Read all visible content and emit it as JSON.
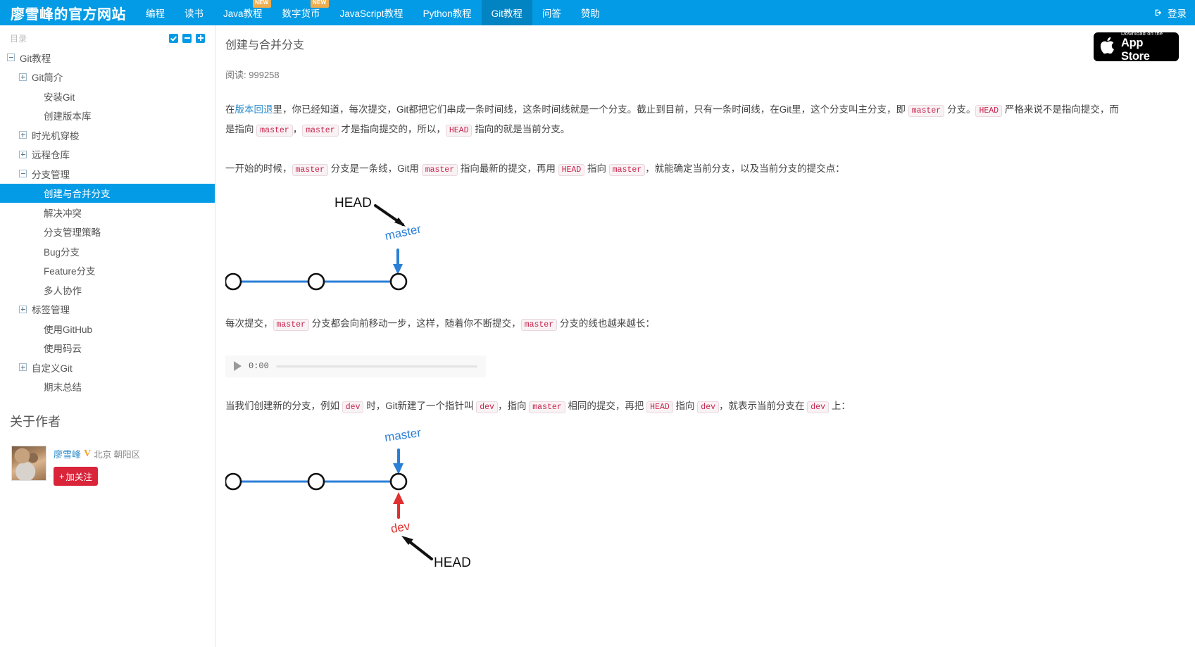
{
  "navbar": {
    "brand": "廖雪峰的官方网站",
    "items": [
      {
        "label": "编程",
        "badge": null,
        "active": false
      },
      {
        "label": "读书",
        "badge": null,
        "active": false
      },
      {
        "label": "Java教程",
        "badge": "NEW",
        "active": false
      },
      {
        "label": "数字货币",
        "badge": "NEW",
        "active": false
      },
      {
        "label": "JavaScript教程",
        "badge": null,
        "active": false
      },
      {
        "label": "Python教程",
        "badge": null,
        "active": false
      },
      {
        "label": "Git教程",
        "badge": null,
        "active": true
      },
      {
        "label": "问答",
        "badge": null,
        "active": false
      },
      {
        "label": "赞助",
        "badge": null,
        "active": false
      }
    ],
    "login_label": "登录",
    "login_icon": "sign-in-icon",
    "bg_color": "#039BE5",
    "active_bg_color": "#0283c2"
  },
  "sidebar": {
    "toc_title": "目录",
    "toc_actions": [
      {
        "name": "check-all-button",
        "icon": "check-icon"
      },
      {
        "name": "collapse-all-button",
        "icon": "minus-icon"
      },
      {
        "name": "expand-all-button",
        "icon": "plus-icon"
      }
    ],
    "tree": [
      {
        "label": "Git教程",
        "indent": 0,
        "toggle": "minus",
        "selected": false
      },
      {
        "label": "Git简介",
        "indent": 1,
        "toggle": "plus",
        "selected": false
      },
      {
        "label": "安装Git",
        "indent": 2,
        "toggle": "none",
        "selected": false
      },
      {
        "label": "创建版本库",
        "indent": 2,
        "toggle": "none",
        "selected": false
      },
      {
        "label": "时光机穿梭",
        "indent": 1,
        "toggle": "plus",
        "selected": false
      },
      {
        "label": "远程仓库",
        "indent": 1,
        "toggle": "plus",
        "selected": false
      },
      {
        "label": "分支管理",
        "indent": 1,
        "toggle": "minus",
        "selected": false
      },
      {
        "label": "创建与合并分支",
        "indent": 2,
        "toggle": "none",
        "selected": true
      },
      {
        "label": "解决冲突",
        "indent": 2,
        "toggle": "none",
        "selected": false
      },
      {
        "label": "分支管理策略",
        "indent": 2,
        "toggle": "none",
        "selected": false
      },
      {
        "label": "Bug分支",
        "indent": 2,
        "toggle": "none",
        "selected": false
      },
      {
        "label": "Feature分支",
        "indent": 2,
        "toggle": "none",
        "selected": false
      },
      {
        "label": "多人协作",
        "indent": 2,
        "toggle": "none",
        "selected": false
      },
      {
        "label": "标签管理",
        "indent": 1,
        "toggle": "plus",
        "selected": false
      },
      {
        "label": "使用GitHub",
        "indent": 2,
        "toggle": "none",
        "selected": false
      },
      {
        "label": "使用码云",
        "indent": 2,
        "toggle": "none",
        "selected": false
      },
      {
        "label": "自定义Git",
        "indent": 1,
        "toggle": "plus",
        "selected": false
      },
      {
        "label": "期末总结",
        "indent": 2,
        "toggle": "none",
        "selected": false
      }
    ],
    "about_title": "关于作者",
    "author": {
      "name": "廖雪峰",
      "verified_badge": "V",
      "location": "北京 朝阳区",
      "follow_label": "加关注",
      "follow_plus": "+",
      "follow_color": "#d9243a",
      "avatar_alt": "author-avatar"
    }
  },
  "main": {
    "title": "创建与合并分支",
    "read_label": "阅读:",
    "read_count": "999258",
    "appstore": {
      "line1": "Download on the",
      "line2": "App Store",
      "icon": "apple-icon"
    },
    "paragraph1": {
      "p1": "在",
      "link": "版本回退",
      "p2": "里，你已经知道，每次提交，Git都把它们串成一条时间线，这条时间线就是一个分支。截止到目前，只有一条时间线，在Git里，这个分支叫主分支，即 ",
      "code1": "master",
      "p3": " 分支。",
      "code2": "HEAD",
      "p4": " 严格来说不是指向提交，而是指向 ",
      "code3": "master",
      "p5": "，",
      "code4": "master",
      "p6": " 才是指向提交的，所以，",
      "code5": "HEAD",
      "p7": " 指向的就是当前分支。"
    },
    "paragraph2": {
      "p1": "一开始的时候，",
      "code1": "master",
      "p2": " 分支是一条线，Git用 ",
      "code2": "master",
      "p3": " 指向最新的提交，再用 ",
      "code3": "HEAD",
      "p4": " 指向 ",
      "code4": "master",
      "p5": "，就能确定当前分支，以及当前分支的提交点："
    },
    "paragraph3": {
      "p1": "每次提交，",
      "code1": "master",
      "p2": " 分支都会向前移动一步，这样，随着你不断提交，",
      "code2": "master",
      "p3": " 分支的线也越来越长："
    },
    "paragraph4": {
      "p1": "当我们创建新的分支，例如 ",
      "code1": "dev",
      "p2": " 时，Git新建了一个指针叫 ",
      "code2": "dev",
      "p3": "，指向 ",
      "code3": "master",
      "p4": " 相同的提交，再把 ",
      "code4": "HEAD",
      "p5": " 指向 ",
      "code5": "dev",
      "p6": "，就表示当前分支在 ",
      "code6": "dev",
      "p7": " 上："
    },
    "audio": {
      "time": "0:00",
      "play_icon": "play-icon"
    },
    "diagram1": {
      "head_label": "HEAD",
      "master_label": "master",
      "commit_count": 3,
      "branch_color": "#2b7fd6",
      "head_color": "#111111"
    },
    "diagram2": {
      "head_label": "HEAD",
      "master_label": "master",
      "dev_label": "dev",
      "commit_count": 3,
      "branch_color": "#2b7fd6",
      "dev_color": "#e03131",
      "head_color": "#111111"
    }
  }
}
